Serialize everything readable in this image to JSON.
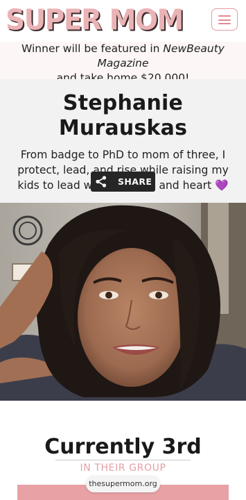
{
  "header": {
    "logo_text": "SUPER MOM",
    "menu_icon": "hamburger-menu-icon"
  },
  "promo": {
    "line1_prefix": "Winner will be featured in ",
    "line1_magazine": "NewBeauty Magazine",
    "line2": "and take home $20,000!"
  },
  "profile": {
    "name": "Stephanie Murauskas",
    "bio": "From badge to PhD to mom of three, I protect, lead, and rise while raising my kids to lead with strength and heart",
    "heart_emoji": "💜",
    "share_label": "SHARE",
    "share_icon": "share-icon"
  },
  "rank": {
    "title": "Currently 3rd",
    "subtitle": "IN THEIR GROUP"
  },
  "browser": {
    "url": "thesupermom.org"
  },
  "colors": {
    "brand_pink": "#e8a1a4",
    "logo_pink": "#eab3b6",
    "share_bg": "#262626",
    "profile_bg": "#f2f2f2"
  }
}
